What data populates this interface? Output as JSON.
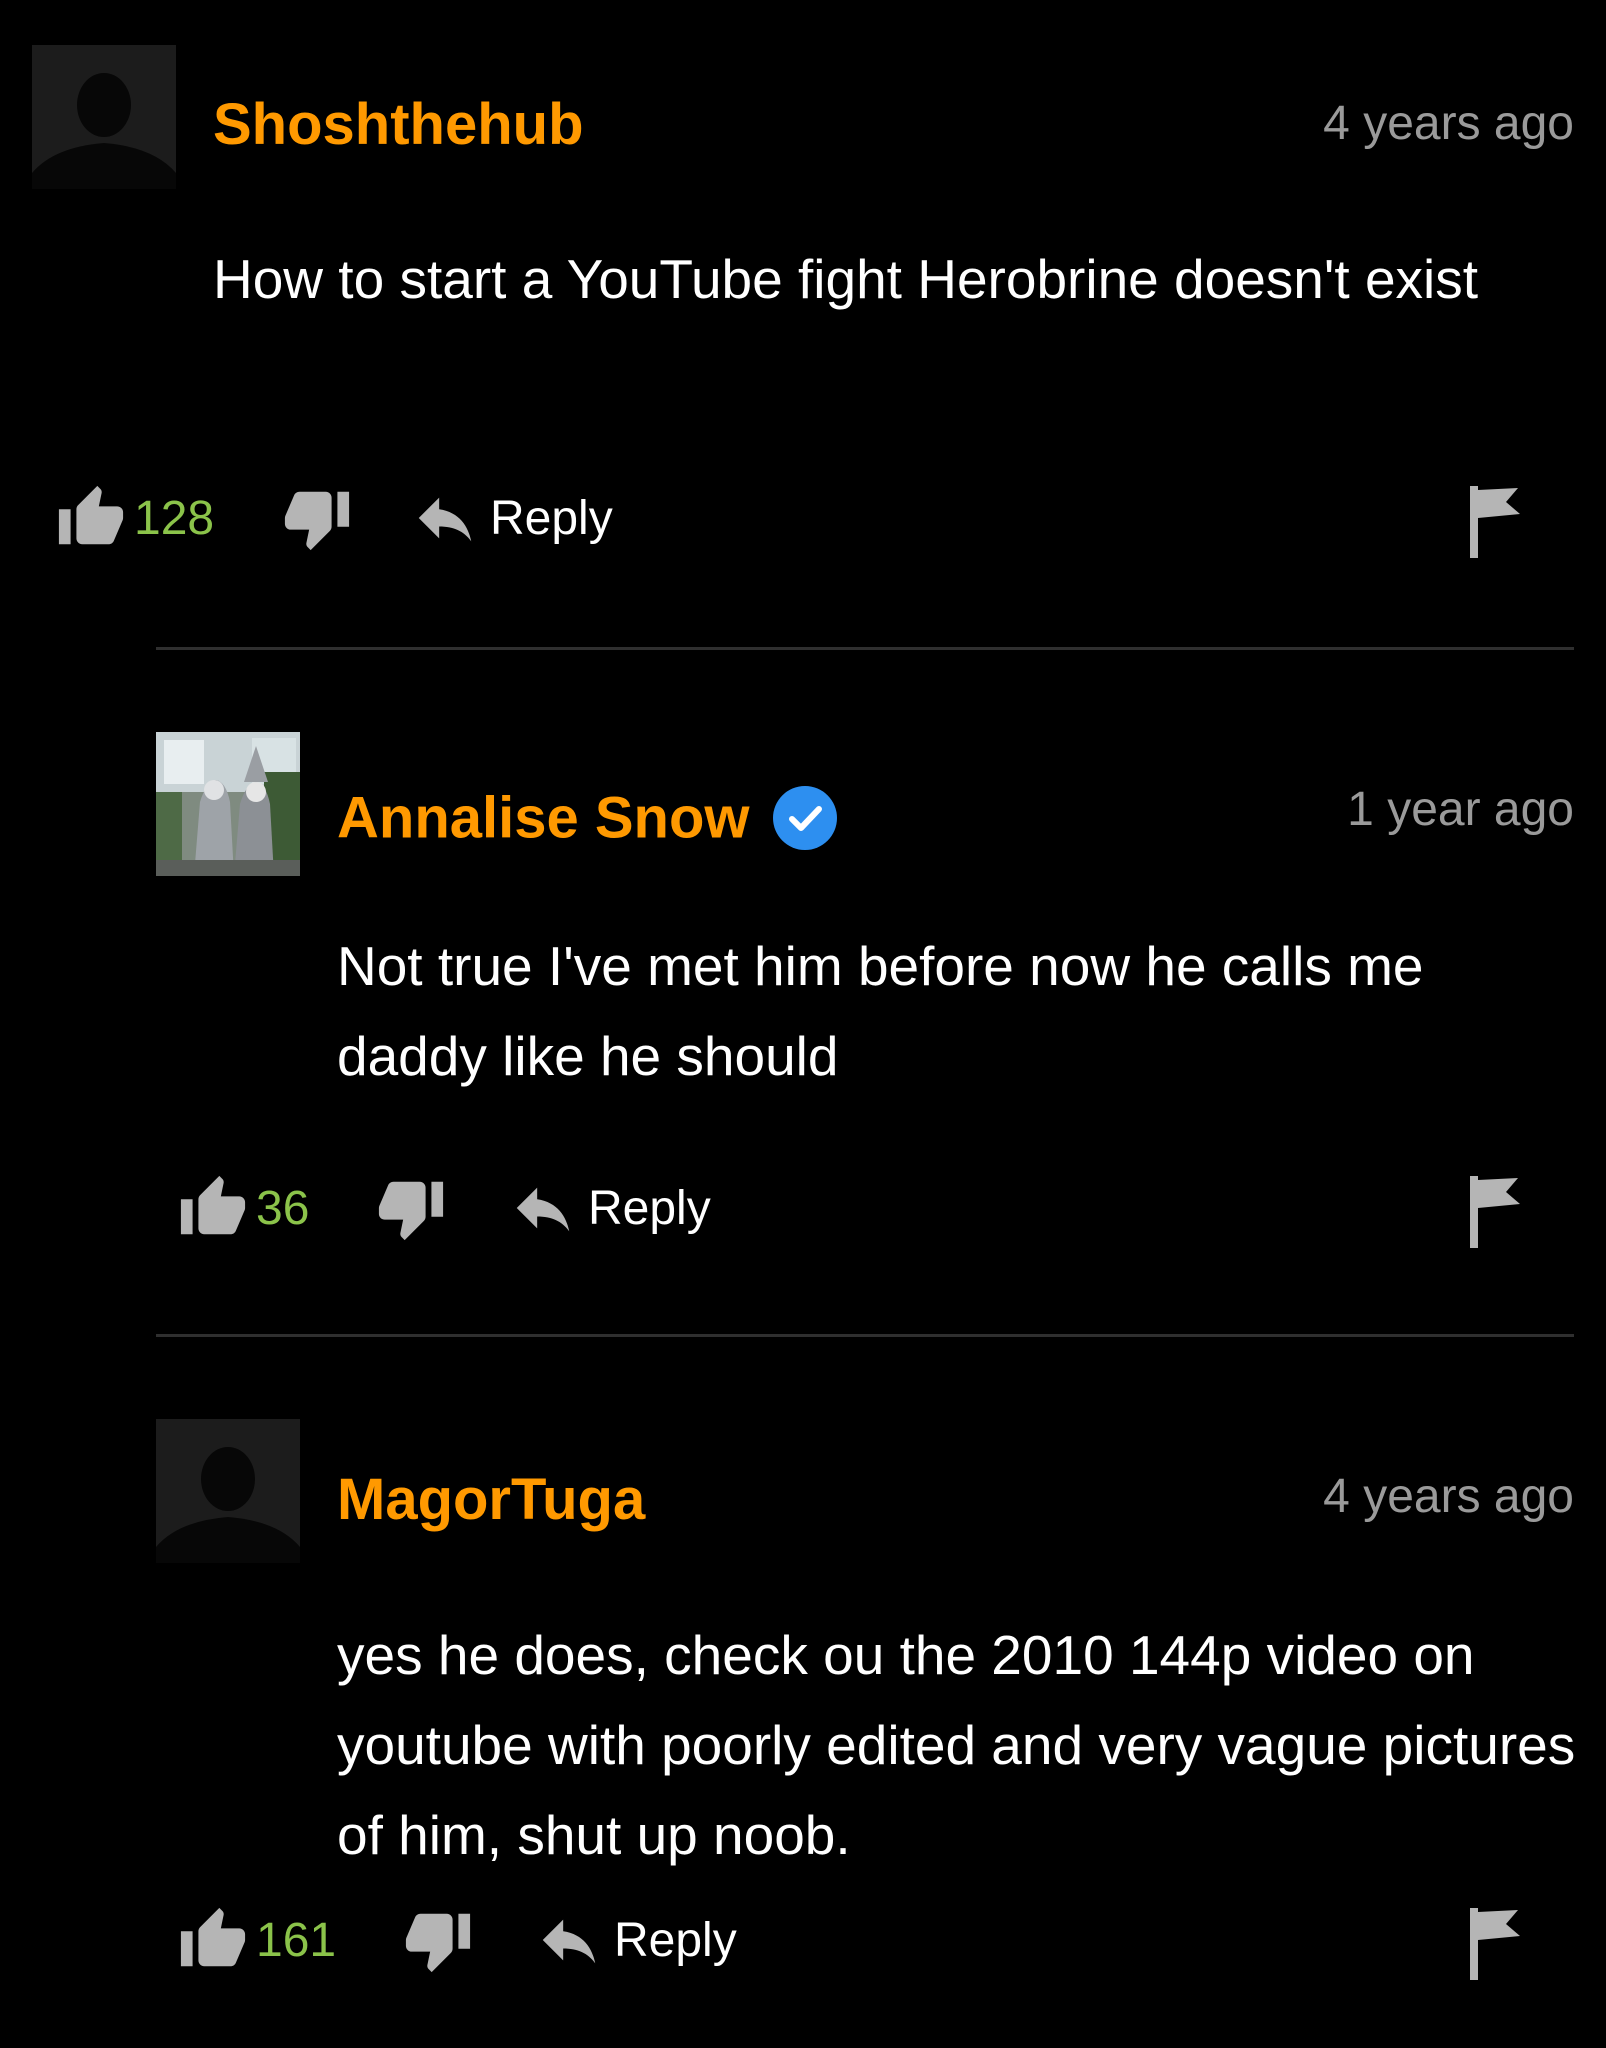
{
  "comments": [
    {
      "username": "Shoshthehub",
      "verified": false,
      "time": "4 years ago",
      "body": "How to start a YouTube fight Herobrine doesn't exist",
      "likes": "128",
      "reply_label": "Reply",
      "avatar_icon": "default-avatar-silhouette"
    },
    {
      "username": "Annalise Snow",
      "verified": true,
      "time": "1 year ago",
      "body": "Not true I've met him before now he calls me daddy like he should",
      "likes": "36",
      "reply_label": "Reply",
      "avatar_icon": "photo-avatar"
    },
    {
      "username": "MagorTuga",
      "verified": false,
      "time": "4 years ago",
      "body": "yes he does, check ou the 2010 144p video on youtube with poorly edited and very vague pictures of him, shut up noob.",
      "likes": "161",
      "reply_label": "Reply",
      "avatar_icon": "default-avatar-silhouette"
    }
  ],
  "colors": {
    "background": "#000000",
    "username": "#ff9900",
    "like_count": "#8bc34a",
    "timestamp": "#9a9a9a",
    "icon_gray": "#b5b5b5",
    "verified_badge": "#2d8ff0"
  }
}
